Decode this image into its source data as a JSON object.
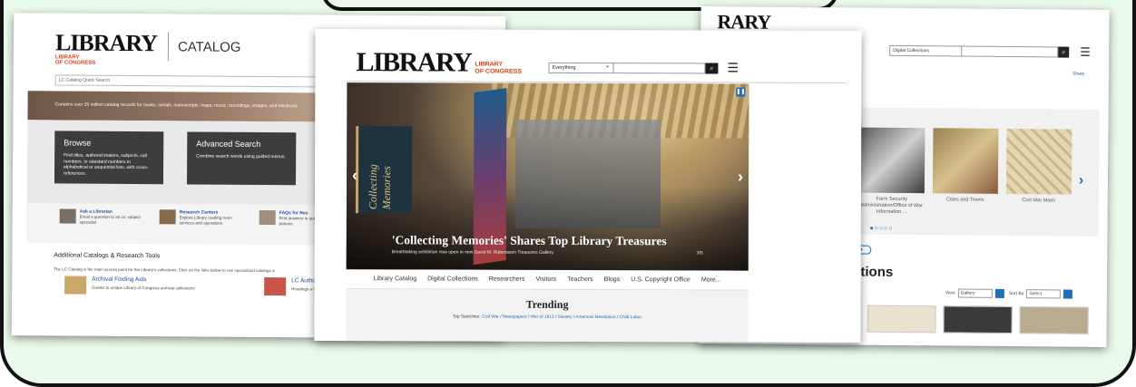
{
  "left": {
    "logo": "LIBRARY",
    "logo_sub": "LIBRARY\nOF CONGRESS",
    "catalog_label": "CATALOG",
    "search_placeholder": "LC Catalog Quick Search",
    "hero_text": "Contains over 20 million catalog records for books, serials, manuscripts, maps, music, recordings, images, and electronic",
    "browse_title": "Browse",
    "browse_desc": "Find titles, authors/creators, subjects, call numbers, or standard numbers in alphabetical or sequential lists, with cross-references.",
    "advanced_title": "Advanced Search",
    "advanced_desc": "Combine search words using guided menus.",
    "helps": [
      {
        "title": "Ask a Librarian",
        "desc": "Email a question to an LC subject specialist"
      },
      {
        "title": "Research Centers",
        "desc": "Explore Library reading room services and operations"
      },
      {
        "title": "FAQs for Res",
        "desc": "Find answers to questions from patrons"
      }
    ],
    "section_title": "Additional Catalogs & Research Tools",
    "section_desc": "The LC Catalog is the main access point for the Library's collections. Click on the links below to use specialized catalogs a",
    "resources": [
      {
        "title": "Archival Finding Aids",
        "desc": "Guides to unique Library of Congress archival collections"
      },
      {
        "title": "LC Autho",
        "desc": "Headings a name/title"
      }
    ]
  },
  "center": {
    "logo": "LIBRARY",
    "logo_sub_1": "LIBRARY",
    "logo_sub_2": "OF CONGRESS",
    "search_select": "Everything",
    "search_icon": "search-icon",
    "hero_panel_text": "Collecting Memories",
    "hero_caption": "'Collecting Memories' Shares Top Library Treasures",
    "hero_subcaption": "Breathtaking exhibition now open in new David M. Rubenstein Treasures Gallery.",
    "hero_count": "3/5",
    "nav": [
      "Library Catalog",
      "Digital Collections",
      "Researchers",
      "Visitors",
      "Teachers",
      "Blogs",
      "U.S. Copyright Office",
      "More..."
    ],
    "trending_title": "Trending",
    "top_searches_label": "Top Searches:",
    "top_searches": [
      "Civil War",
      "Newspapers",
      "War of 1812",
      "Slavery",
      "American Revolution",
      "Child Labor"
    ]
  },
  "right": {
    "logo": "RARY",
    "search_select": "Digital Collections",
    "share": "Share",
    "captions": [
      "Farm Security Administration/Office of War Information ...",
      "Cities and Towns",
      "Civil War Maps"
    ],
    "dots": "●○○○○",
    "heading": "ctions",
    "view_label": "View",
    "view_value": "Gallery",
    "sort_label": "Sort By",
    "sort_value": "Select"
  },
  "colors": {
    "brand_red": "#d64316",
    "link_blue": "#1f6fb8",
    "frame_bg": "#eafaea"
  }
}
